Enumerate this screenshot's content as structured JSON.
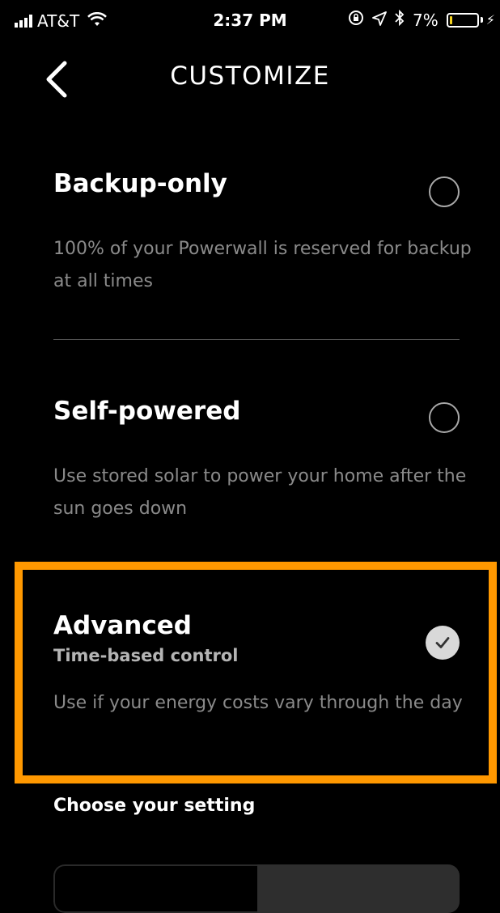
{
  "status_bar": {
    "carrier": "AT&T",
    "time": "2:37 PM",
    "battery_percent": "7%",
    "battery_level": 0.07,
    "battery_fill_color": "#f4d21e",
    "icons": [
      "signal-icon",
      "wifi-icon",
      "rotation-lock-icon",
      "location-icon",
      "bluetooth-icon",
      "battery-icon",
      "charging-icon"
    ]
  },
  "header": {
    "title": "CUSTOMIZE",
    "back_icon": "chevron-left-icon"
  },
  "options": [
    {
      "title": "Backup-only",
      "description": "100% of your Powerwall is reserved for backup at all times",
      "selected": false
    },
    {
      "title": "Self-powered",
      "description": "Use stored solar to power your home after the sun goes down",
      "selected": false
    },
    {
      "title": "Advanced",
      "subtitle": "Time-based control",
      "description": "Use if your energy costs vary through the day",
      "selected": true
    }
  ],
  "highlight_color": "#ff9800",
  "setting": {
    "label": "Choose your setting"
  }
}
